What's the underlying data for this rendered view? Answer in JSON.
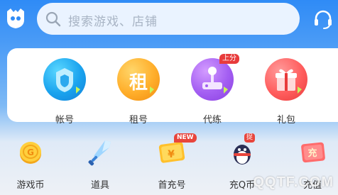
{
  "search": {
    "placeholder": "搜索游戏、店铺"
  },
  "main_items": [
    {
      "label": "帐号",
      "icon": "account-icon"
    },
    {
      "label": "租号",
      "icon": "rent-icon",
      "glyph": "租"
    },
    {
      "label": "代练",
      "icon": "boost-joystick-icon",
      "badge": "上分"
    },
    {
      "label": "礼包",
      "icon": "gift-icon"
    }
  ],
  "sub_items": [
    {
      "label": "游戏币",
      "icon": "coin-icon"
    },
    {
      "label": "道具",
      "icon": "sword-icon"
    },
    {
      "label": "首充号",
      "icon": "first-charge-icon",
      "badge": "NEW"
    },
    {
      "label": "充Q币",
      "icon": "qq-penguin-icon",
      "badge": "捉"
    },
    {
      "label": "充值",
      "icon": "recharge-icon",
      "glyph": "充"
    }
  ],
  "watermark": "QQTF.COM",
  "colors": {
    "brand_blue": "#2f8bf6",
    "hot_red": "#e83b3b"
  }
}
